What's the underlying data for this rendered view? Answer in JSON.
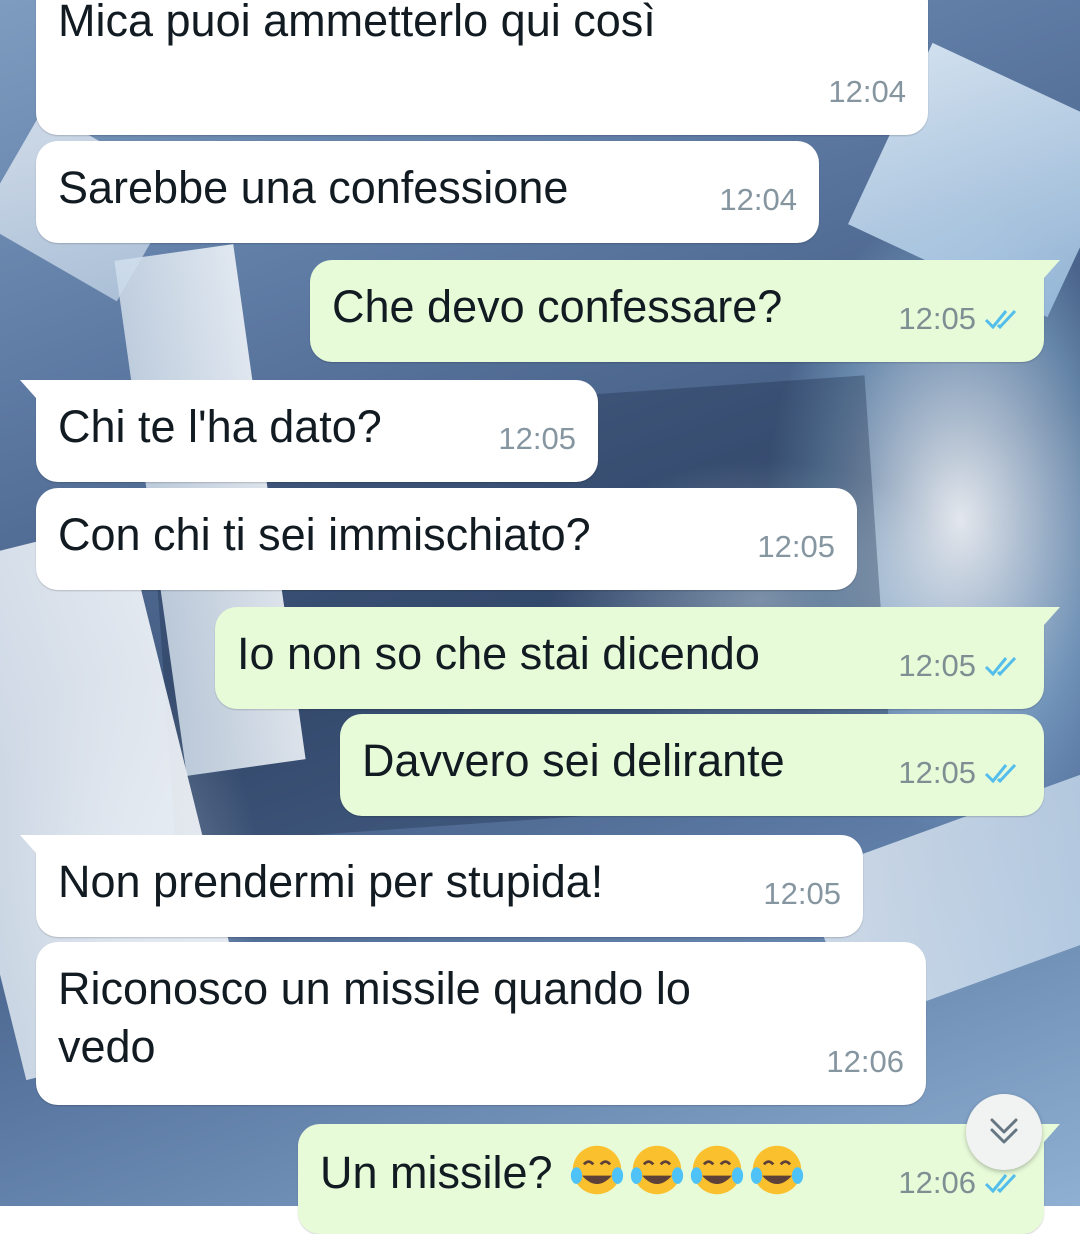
{
  "messages": [
    {
      "direction": "in",
      "text": "Mica puoi ammetterlo qui così",
      "time": "12:04"
    },
    {
      "direction": "in",
      "text": "Sarebbe una confessione",
      "time": "12:04"
    },
    {
      "direction": "out",
      "text": "Che devo confessare?",
      "time": "12:05",
      "status": "read"
    },
    {
      "direction": "in",
      "text": "Chi te l'ha dato?",
      "time": "12:05"
    },
    {
      "direction": "in",
      "text": "Con chi ti sei immischiato?",
      "time": "12:05"
    },
    {
      "direction": "out",
      "text": "Io non so che stai dicendo",
      "time": "12:05",
      "status": "read"
    },
    {
      "direction": "out",
      "text": "Davvero sei delirante",
      "time": "12:05",
      "status": "read"
    },
    {
      "direction": "in",
      "text": "Non prendermi per stupida!",
      "time": "12:05"
    },
    {
      "direction": "in",
      "text_line1": "Riconosco un missile quando lo",
      "text_line2": "vedo",
      "time": "12:06"
    },
    {
      "direction": "out",
      "text": "Un missile?",
      "emoji": "face-with-tears-of-joy x4",
      "time": "12:06",
      "status": "read"
    }
  ],
  "icons": {
    "read_receipt": "double-check-icon",
    "scroll_down": "chevron-double-down-icon"
  },
  "colors": {
    "incoming_bubble": "#ffffff",
    "outgoing_bubble": "#e7fbd9",
    "timestamp": "#8696a0",
    "read_ticks": "#53bdeb"
  }
}
